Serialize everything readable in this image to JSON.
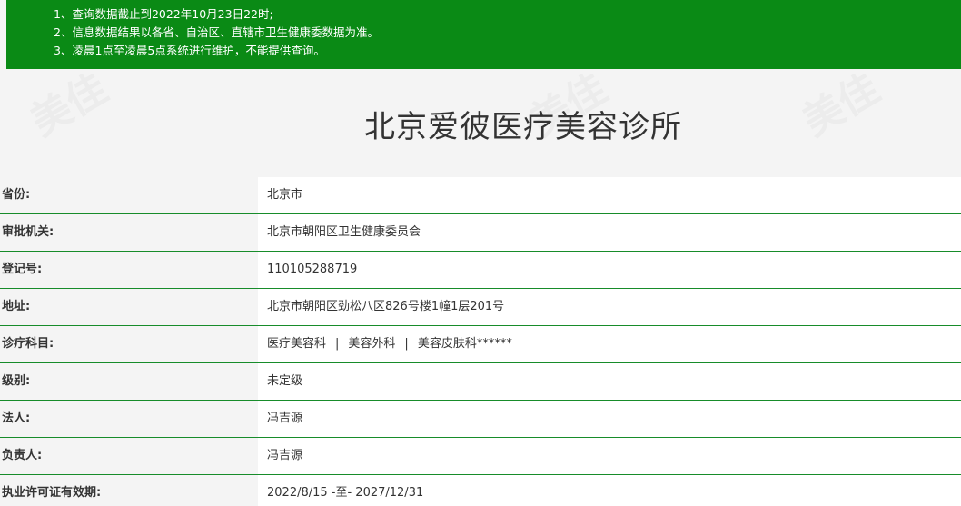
{
  "notice": {
    "line1": "1、查询数据截止到2022年10月23日22时;",
    "line2": "2、信息数据结果以各省、自治区、直辖市卫生健康委数据为准。",
    "line3": "3、凌晨1点至凌晨5点系统进行维护，不能提供查询。"
  },
  "title": "北京爱彼医疗美容诊所",
  "watermark_text": "美佳",
  "rows": [
    {
      "label": "省份:",
      "value": "北京市"
    },
    {
      "label": "审批机关:",
      "value": "北京市朝阳区卫生健康委员会"
    },
    {
      "label": "登记号:",
      "value": "110105288719"
    },
    {
      "label": "地址:",
      "value": "北京市朝阳区劲松八区826号楼1幢1层201号"
    },
    {
      "label": "诊疗科目:",
      "value": ""
    },
    {
      "label": "级别:",
      "value": "未定级"
    },
    {
      "label": "法人:",
      "value": "冯吉源"
    },
    {
      "label": "负责人:",
      "value": "冯吉源"
    },
    {
      "label": "执业许可证有效期:",
      "value": "2022/8/15 -至- 2027/12/31"
    }
  ],
  "subjects": {
    "item1": "医疗美容科",
    "item2": "美容外科",
    "item3": "美容皮肤科******",
    "separator": "|"
  },
  "colors": {
    "notice_bg": "#0a8a15",
    "row_border": "#178c2a"
  }
}
